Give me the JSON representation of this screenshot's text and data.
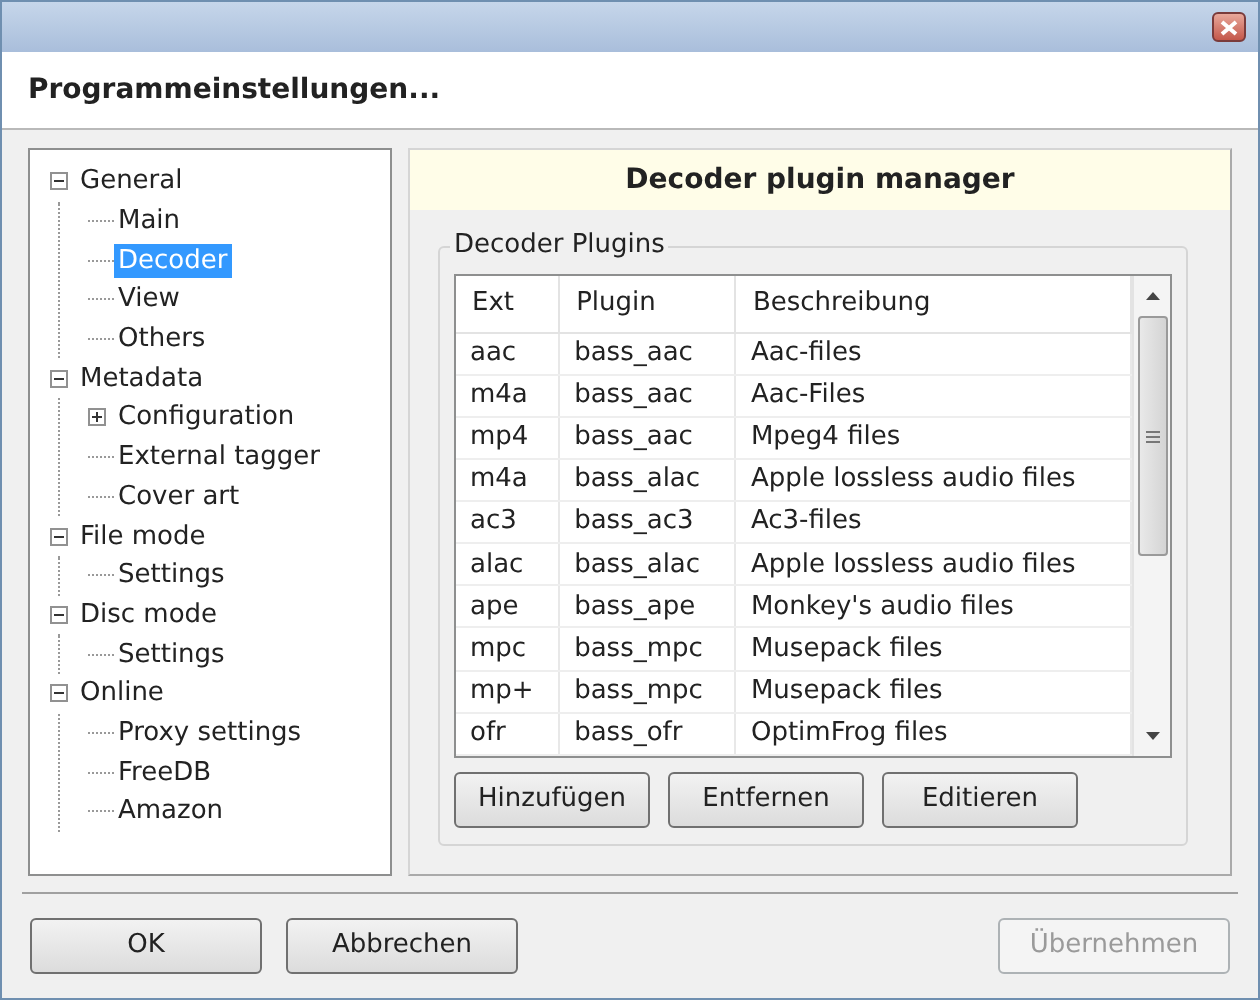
{
  "dialog": {
    "heading": "Programmeinstellungen..."
  },
  "tree": [
    {
      "label": "General",
      "expanded": true,
      "selected": false,
      "children": [
        {
          "label": "Main",
          "selected": false
        },
        {
          "label": "Decoder",
          "selected": true
        },
        {
          "label": "View",
          "selected": false
        },
        {
          "label": "Others",
          "selected": false
        }
      ]
    },
    {
      "label": "Metadata",
      "expanded": true,
      "selected": false,
      "children": [
        {
          "label": "Configuration",
          "expanded": false,
          "selected": false
        },
        {
          "label": "External tagger",
          "selected": false
        },
        {
          "label": "Cover art",
          "selected": false
        }
      ]
    },
    {
      "label": "File mode",
      "expanded": true,
      "selected": false,
      "children": [
        {
          "label": "Settings",
          "selected": false
        }
      ]
    },
    {
      "label": "Disc mode",
      "expanded": true,
      "selected": false,
      "children": [
        {
          "label": "Settings",
          "selected": false
        }
      ]
    },
    {
      "label": "Online",
      "expanded": true,
      "selected": false,
      "children": [
        {
          "label": "Proxy settings",
          "selected": false
        },
        {
          "label": "FreeDB",
          "selected": false
        },
        {
          "label": "Amazon",
          "selected": false
        }
      ]
    }
  ],
  "panel": {
    "title": "Decoder plugin manager",
    "group_title": "Decoder Plugins",
    "table": {
      "columns": [
        "Ext",
        "Plugin",
        "Beschreibung"
      ],
      "rows": [
        [
          "aac",
          "bass_aac",
          "Aac-files"
        ],
        [
          "m4a",
          "bass_aac",
          "Aac-Files"
        ],
        [
          "mp4",
          "bass_aac",
          "Mpeg4 files"
        ],
        [
          "m4a",
          "bass_alac",
          "Apple lossless audio files"
        ],
        [
          "ac3",
          "bass_ac3",
          "Ac3-files"
        ],
        [
          "alac",
          "bass_alac",
          "Apple lossless audio files"
        ],
        [
          "ape",
          "bass_ape",
          "Monkey's audio files"
        ],
        [
          "mpc",
          "bass_mpc",
          "Musepack files"
        ],
        [
          "mp+",
          "bass_mpc",
          "Musepack files"
        ],
        [
          "ofr",
          "bass_ofr",
          "OptimFrog files"
        ]
      ]
    },
    "buttons": [
      {
        "label": "Hinzufügen",
        "disabled": false
      },
      {
        "label": "Entfernen",
        "disabled": false
      },
      {
        "label": "Editieren",
        "disabled": false
      }
    ]
  },
  "footer_buttons": [
    {
      "label": "OK",
      "disabled": false
    },
    {
      "label": "Abbrechen",
      "disabled": false
    },
    {
      "label": "Übernehmen",
      "disabled": true
    }
  ]
}
